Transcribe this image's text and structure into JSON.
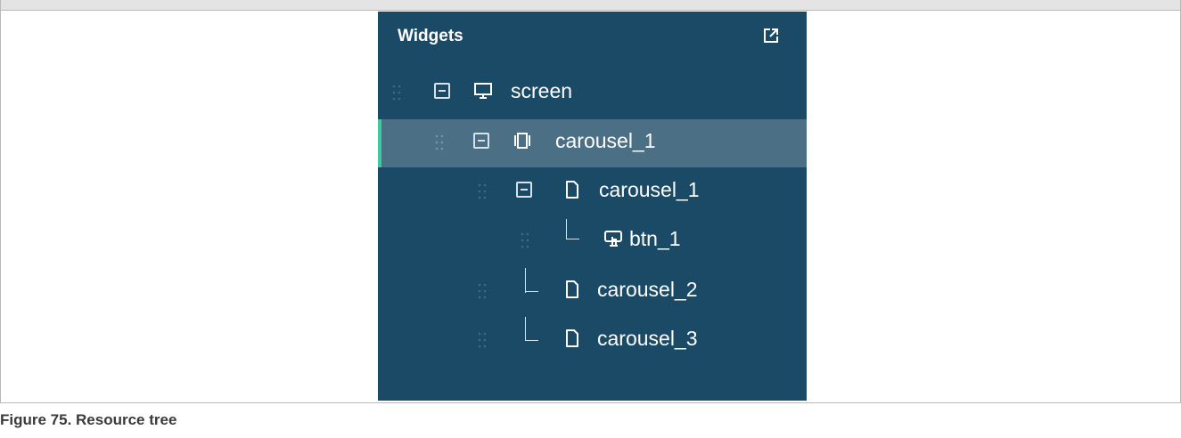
{
  "panel": {
    "title": "Widgets",
    "colors": {
      "background": "#1b4a66",
      "selected": "#4b6f85",
      "accent": "#3ec9a0"
    }
  },
  "tree": [
    {
      "label": "screen",
      "icon": "monitor-icon",
      "level": 0,
      "expandable": true,
      "selected": false
    },
    {
      "label": "carousel_1",
      "icon": "carousel-icon",
      "level": 1,
      "expandable": true,
      "selected": true
    },
    {
      "label": "carousel_1",
      "icon": "page-icon",
      "level": 2,
      "expandable": true,
      "selected": false
    },
    {
      "label": "btn_1",
      "icon": "button-icon",
      "level": 3,
      "expandable": false,
      "selected": false
    },
    {
      "label": "carousel_2",
      "icon": "page-icon",
      "level": 2,
      "expandable": false,
      "selected": false
    },
    {
      "label": "carousel_3",
      "icon": "page-icon",
      "level": 2,
      "expandable": false,
      "selected": false
    }
  ],
  "caption": "Figure 75.  Resource tree"
}
